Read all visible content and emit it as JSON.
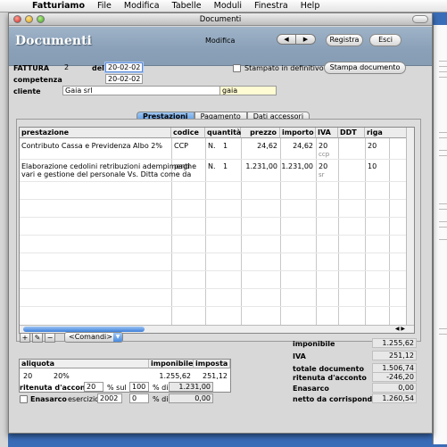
{
  "menubar": {
    "app": "Fatturiamo",
    "items": [
      "File",
      "Modifica",
      "Tabelle",
      "Moduli",
      "Finestra",
      "Help"
    ]
  },
  "window": {
    "title": "Documenti",
    "header_title": "Documenti",
    "mode": "Modifica",
    "prev_glyph": "◀",
    "next_glyph": "▶",
    "register_label": "Registra",
    "exit_label": "Esci"
  },
  "form": {
    "type_label": "FATTURA",
    "number": "2",
    "del_label": "del",
    "date": "20-02-02",
    "competenza_label": "competenza",
    "competenza": "20-02-02",
    "client_label": "cliente",
    "client_name": "Gaia srl",
    "client_code": "gaia",
    "printed_label": "Stampato in definitivo",
    "print_button": "Stampa documento"
  },
  "tabs": [
    "Prestazioni",
    "Pagamento",
    "Dati accessori"
  ],
  "grid": {
    "headers": [
      "prestazione",
      "codice",
      "quantità",
      "prezzo",
      "importo",
      "IVA",
      "DDT",
      "riga"
    ],
    "rows": [
      {
        "prestazione": "Contributo Cassa e Previdenza Albo 2%",
        "prestazione2": "",
        "codice": "CCP",
        "unit": "N.",
        "qty": "1",
        "prezzo": "24,62",
        "importo": "24,62",
        "iva": "20",
        "iva_code": "ccp",
        "ddt": "",
        "riga": "20"
      },
      {
        "prestazione": "Elaborazione cedolini retribuzioni adempimenti",
        "prestazione2": "vari e gestione del personale Vs. Ditta come da",
        "codice": "paghe",
        "unit": "N.",
        "qty": "1",
        "prezzo": "1.231,00",
        "importo": "1.231,00",
        "iva": "20",
        "iva_code": "sr",
        "ddt": "",
        "riga": "10"
      }
    ]
  },
  "controls": {
    "add": "+",
    "edit": "✎",
    "remove": "−",
    "commands": "<Comandi>"
  },
  "iva_table": {
    "headers": [
      "aliquota",
      "imponibile",
      "imposta"
    ],
    "rows": [
      {
        "code": "20",
        "desc": "20%",
        "imponibile": "1.255,62",
        "imposta": "251,12"
      }
    ]
  },
  "ritenuta": {
    "label": "ritenuta d'acconto",
    "pct": "20",
    "sul_label": "% sul",
    "base_pct": "100",
    "di_label": "% di",
    "amount": "1.231,00"
  },
  "enasarco": {
    "label": "Enasarco",
    "esercizio_label": "esercizio",
    "year": "2002",
    "pct": "0",
    "di_label": "% di",
    "amount": "0,00"
  },
  "totals": [
    {
      "label": "imponibile",
      "value": "1.255,62"
    },
    {
      "label": "IVA",
      "value": "251,12"
    },
    {
      "label": "totale documento",
      "value": "1.506,74"
    },
    {
      "label": "ritenuta d'acconto",
      "value": "-246,20"
    },
    {
      "label": "Enasarco",
      "value": "0,00"
    },
    {
      "label": "netto da corrispondere",
      "value": "1.260,54"
    }
  ]
}
